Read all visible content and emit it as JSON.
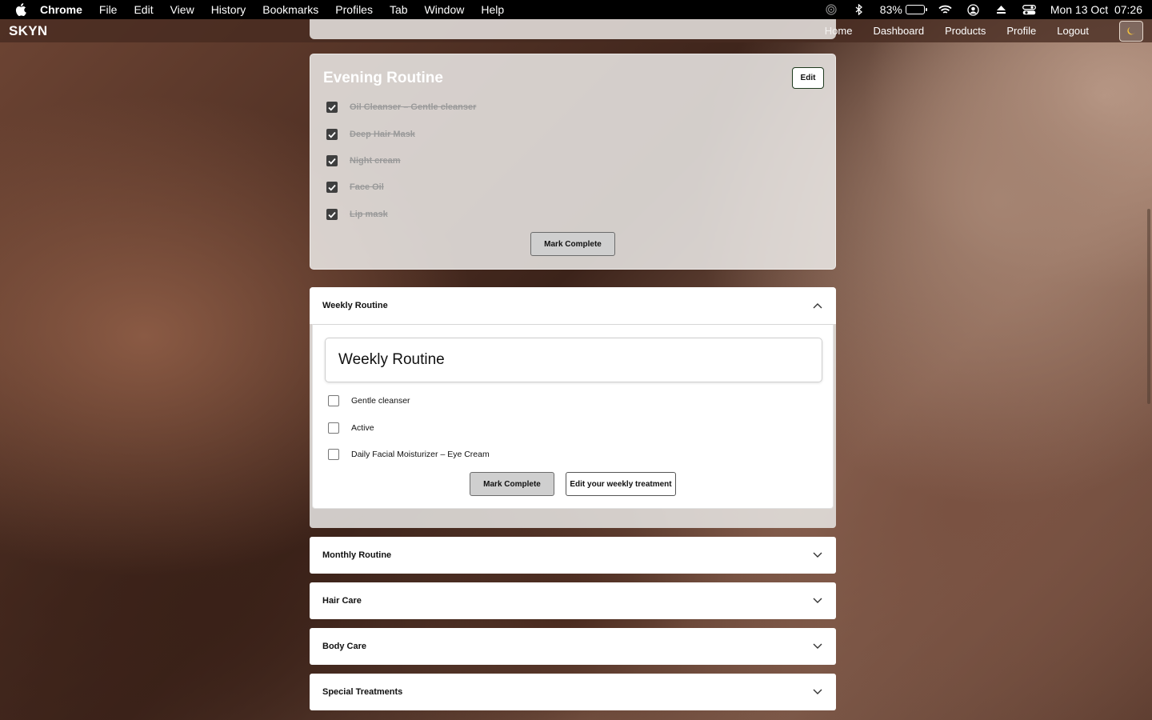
{
  "menubar": {
    "app_name": "Chrome",
    "items": [
      "File",
      "Edit",
      "View",
      "History",
      "Bookmarks",
      "Profiles",
      "Tab",
      "Window",
      "Help"
    ],
    "battery_percent": "83%",
    "battery_level": 0.83,
    "datetime": "Mon 13 Oct  07:26"
  },
  "navbar": {
    "brand": "SKYN",
    "links": [
      "Home",
      "Dashboard",
      "Products",
      "Profile",
      "Logout"
    ],
    "theme_icon": "moon-icon"
  },
  "evening": {
    "title": "Evening Routine",
    "edit_label": "Edit",
    "items": [
      {
        "label": "Oil Cleanser – Gentle cleanser",
        "checked": true
      },
      {
        "label": "Deep Hair Mask",
        "checked": true
      },
      {
        "label": "Night cream",
        "checked": true
      },
      {
        "label": "Face Oil",
        "checked": true
      },
      {
        "label": "Lip mask",
        "checked": true
      }
    ],
    "mark_complete_label": "Mark Complete"
  },
  "weekly": {
    "header": "Weekly Routine",
    "title": "Weekly Routine",
    "items": [
      {
        "label": "Gentle cleanser",
        "checked": false
      },
      {
        "label": "Active",
        "checked": false
      },
      {
        "label": "Daily Facial Moisturizer – Eye Cream",
        "checked": false
      }
    ],
    "mark_complete_label": "Mark Complete",
    "edit_treatment_label": "Edit your weekly treatment"
  },
  "sections": [
    {
      "label": "Monthly Routine"
    },
    {
      "label": "Hair Care"
    },
    {
      "label": "Body Care"
    },
    {
      "label": "Special Treatments"
    }
  ],
  "colors": {
    "menubar_bg": "#000000",
    "check_fill": "#3f3f3f",
    "button_gray": "#cfcfcf",
    "edit_border": "#1e3a1e"
  }
}
